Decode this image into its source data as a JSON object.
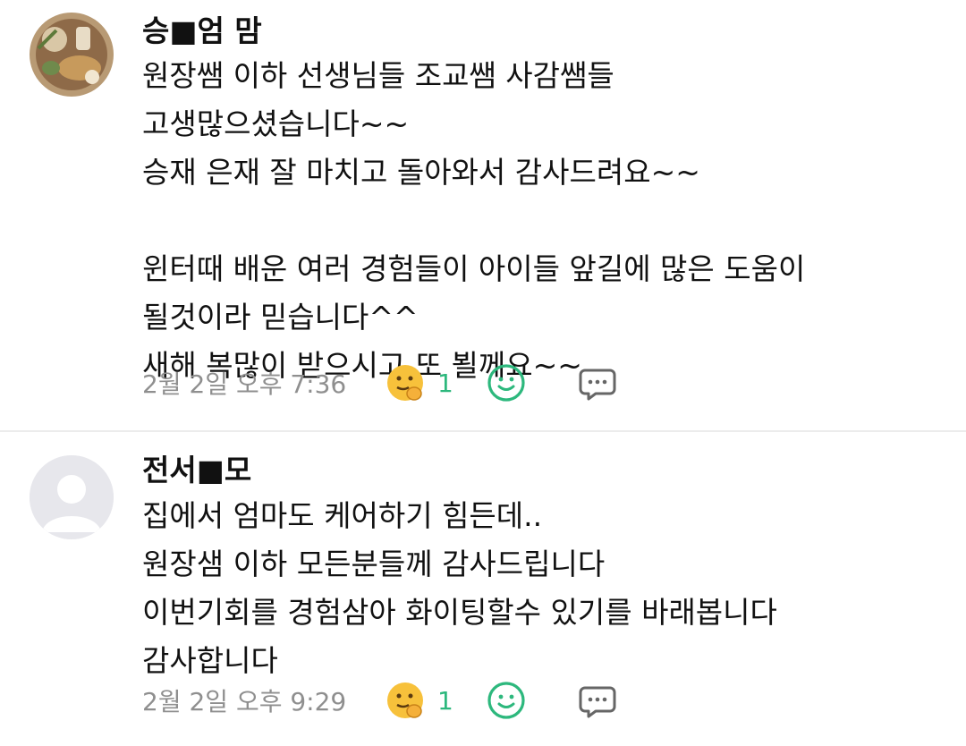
{
  "comments": [
    {
      "author": "승■엄 맘",
      "lines": [
        "원장쌤 이하 선생님들 조교쌤 사감쌤들",
        "고생많으셨습니다~~",
        "승재 은재 잘 마치고 돌아와서 감사드려요~~",
        "",
        "윈터때 배운 여러 경험들이 아이들 앞길에 많은 도움이",
        "될것이라 믿습니다^^",
        "새해 복많이 받으시고 또 뵐께요~~"
      ],
      "timestamp": "2월 2일 오후 7:36",
      "reaction_count": "1"
    },
    {
      "author": "전서■모",
      "lines": [
        "집에서 엄마도 케어하기 힘든데..",
        "원장샘 이하 모든분들께 감사드립니다",
        "이번기회를 경험삼아 화이팅할수 있기를 바래봅니다",
        "감사합니다"
      ],
      "timestamp": "2월 2일 오후 9:29",
      "reaction_count": "1"
    }
  ],
  "colors": {
    "accent_green": "#2db87d",
    "timestamp_gray": "#8f8f8f",
    "divider": "#ececec"
  },
  "icons": [
    "emoji-reaction-icon",
    "add-reaction-smile-icon",
    "reply-comment-icon",
    "profile-photo",
    "default-avatar-icon"
  ]
}
